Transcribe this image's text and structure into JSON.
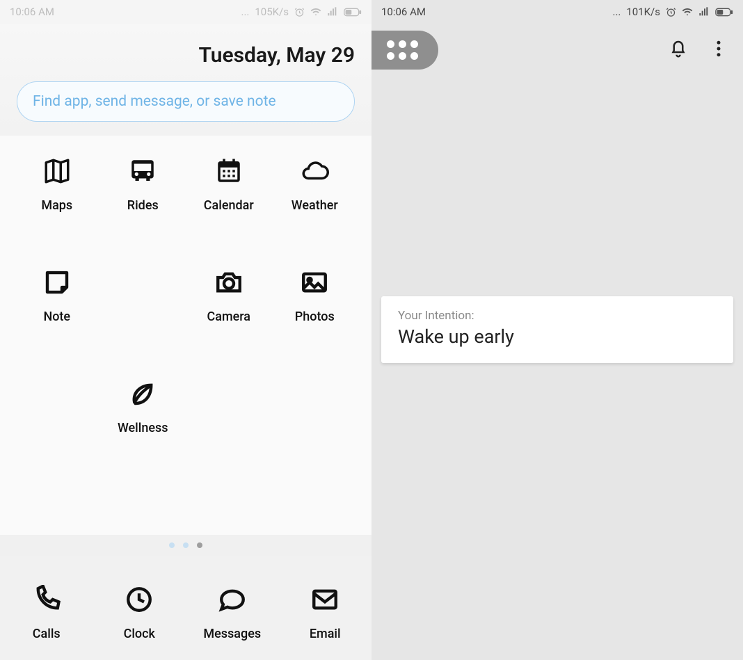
{
  "left": {
    "statusbar": {
      "time": "10:06 AM",
      "speed": "105K/s"
    },
    "date": "Tuesday, May 29",
    "search_placeholder": "Find app, send message, or save note",
    "apps": [
      {
        "label": "Maps",
        "icon": "map-icon"
      },
      {
        "label": "Rides",
        "icon": "bus-icon"
      },
      {
        "label": "Calendar",
        "icon": "calendar-icon"
      },
      {
        "label": "Weather",
        "icon": "cloud-icon"
      },
      {
        "label": "Note",
        "icon": "note-icon"
      },
      {
        "label": "",
        "icon": ""
      },
      {
        "label": "Camera",
        "icon": "camera-icon"
      },
      {
        "label": "Photos",
        "icon": "photo-icon"
      },
      {
        "label": "",
        "icon": ""
      },
      {
        "label": "Wellness",
        "icon": "leaf-icon"
      }
    ],
    "dock": [
      {
        "label": "Calls",
        "icon": "phone-icon"
      },
      {
        "label": "Clock",
        "icon": "clock-icon"
      },
      {
        "label": "Messages",
        "icon": "chat-icon"
      },
      {
        "label": "Email",
        "icon": "mail-icon"
      }
    ]
  },
  "right": {
    "statusbar": {
      "time": "10:06 AM",
      "speed": "101K/s"
    },
    "intent": {
      "label": "Your Intention:",
      "text": "Wake up early"
    }
  }
}
